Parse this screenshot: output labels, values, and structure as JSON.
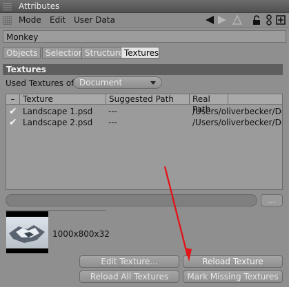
{
  "window": {
    "title": "Attributes"
  },
  "menu": {
    "items": [
      "Mode",
      "Edit",
      "User Data"
    ]
  },
  "object_name": "Monkey",
  "tabs": [
    {
      "label": "Objects",
      "active": false
    },
    {
      "label": "Selection",
      "active": false
    },
    {
      "label": "Structure",
      "active": false
    },
    {
      "label": "Textures",
      "active": true
    }
  ],
  "section": {
    "title": "Textures"
  },
  "used": {
    "label": "Used Textures of",
    "value": "Document"
  },
  "table": {
    "headers": [
      "–",
      "Texture",
      "Suggested Path",
      "Real Path"
    ],
    "rows": [
      {
        "check": "✔",
        "texture": "Landscape 1.psd",
        "suggested": "---",
        "real": "/Users/oliverbecker/Des"
      },
      {
        "check": "✔",
        "texture": "Landscape 2.psd",
        "suggested": "---",
        "real": "/Users/oliverbecker/Des"
      }
    ]
  },
  "browse_label": "...",
  "preview": {
    "dimensions": "1000x800x32"
  },
  "buttons": {
    "edit": "Edit Texture...",
    "reload": "Reload Texture",
    "reload_all": "Reload All Textures",
    "mark_missing": "Mark Missing Textures"
  },
  "annotation": {
    "arrow_color": "#e0161b",
    "points_to": "Reload Texture"
  },
  "icons": [
    "back-arrow-icon",
    "forward-arrow-icon",
    "up-icon",
    "lock-icon",
    "link-icon",
    "new-window-icon"
  ]
}
